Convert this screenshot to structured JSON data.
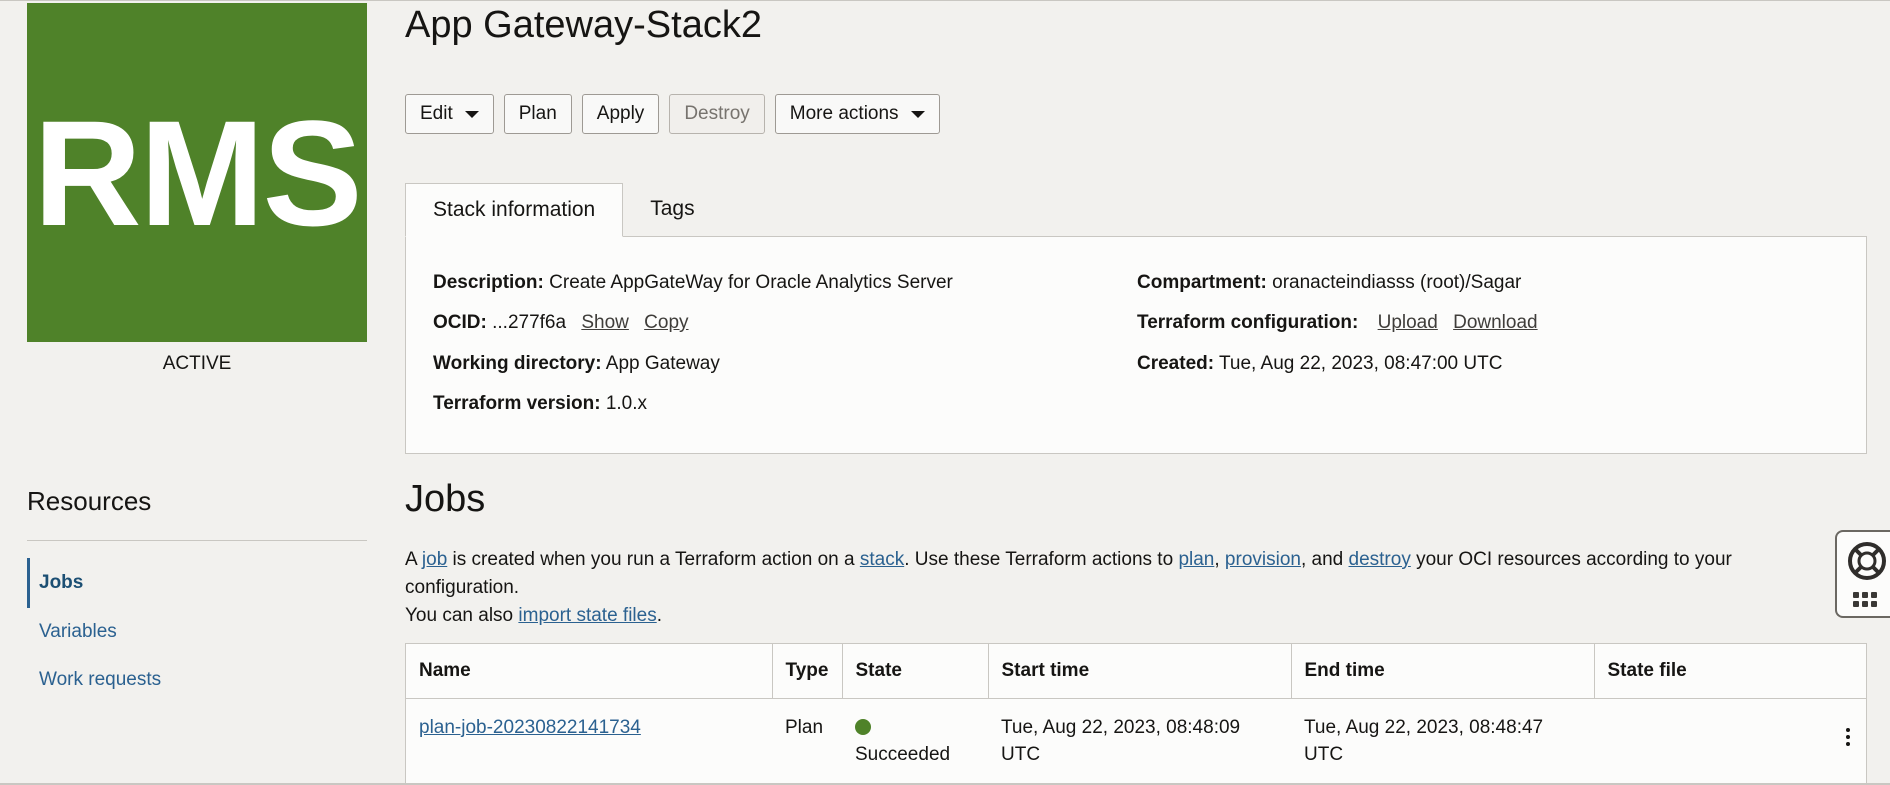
{
  "stack": {
    "logo_text": "RMS",
    "lifecycle_state": "ACTIVE",
    "title": "App Gateway-Stack2"
  },
  "actions": {
    "edit": "Edit",
    "plan": "Plan",
    "apply": "Apply",
    "destroy": "Destroy",
    "more": "More actions"
  },
  "tabs": [
    {
      "label": "Stack information",
      "active": true
    },
    {
      "label": "Tags",
      "active": false
    }
  ],
  "info": {
    "description_label": "Description:",
    "description_value": "Create AppGateWay for Oracle Analytics Server",
    "ocid_label": "OCID:",
    "ocid_value": "...277f6a",
    "ocid_show": "Show",
    "ocid_copy": "Copy",
    "workdir_label": "Working directory:",
    "workdir_value": "App Gateway",
    "tfversion_label": "Terraform version:",
    "tfversion_value": "1.0.x",
    "compartment_label": "Compartment:",
    "compartment_value": "oranacteindiasss (root)/Sagar",
    "tfconfig_label": "Terraform configuration:",
    "tfconfig_upload": "Upload",
    "tfconfig_download": "Download",
    "created_label": "Created:",
    "created_value": "Tue, Aug 22, 2023, 08:47:00 UTC"
  },
  "resources": {
    "title": "Resources",
    "items": [
      {
        "label": "Jobs",
        "active": true
      },
      {
        "label": "Variables",
        "active": false
      },
      {
        "label": "Work requests",
        "active": false
      }
    ]
  },
  "jobs": {
    "title": "Jobs",
    "desc": {
      "t1": "A ",
      "l_job": "job",
      "t2": " is created when you run a Terraform action on a ",
      "l_stack": "stack",
      "t3": ". Use these Terraform actions to ",
      "l_plan": "plan",
      "t4": ", ",
      "l_provision": "provision",
      "t5": ", and ",
      "l_destroy": "destroy",
      "t6": " your OCI resources according to your configuration.",
      "t7": "You can also ",
      "l_import": "import state files",
      "t8": "."
    },
    "columns": [
      "Name",
      "Type",
      "State",
      "Start time",
      "End time",
      "State file"
    ],
    "rows": [
      {
        "name": "plan-job-20230822141734",
        "type": "Plan",
        "state": "Succeeded",
        "start_line1": "Tue, Aug 22, 2023, 08:48:09",
        "start_line2": "UTC",
        "end_line1": "Tue, Aug 22, 2023, 08:48:47",
        "end_line2": "UTC",
        "state_file": ""
      }
    ]
  },
  "colors": {
    "logo_bg": "#4f8229",
    "link": "#2b6190",
    "success": "#4f8229"
  },
  "icons": {
    "help": "lifebuoy-icon",
    "apps": "grid-icon",
    "row_menu": "kebab-icon"
  }
}
